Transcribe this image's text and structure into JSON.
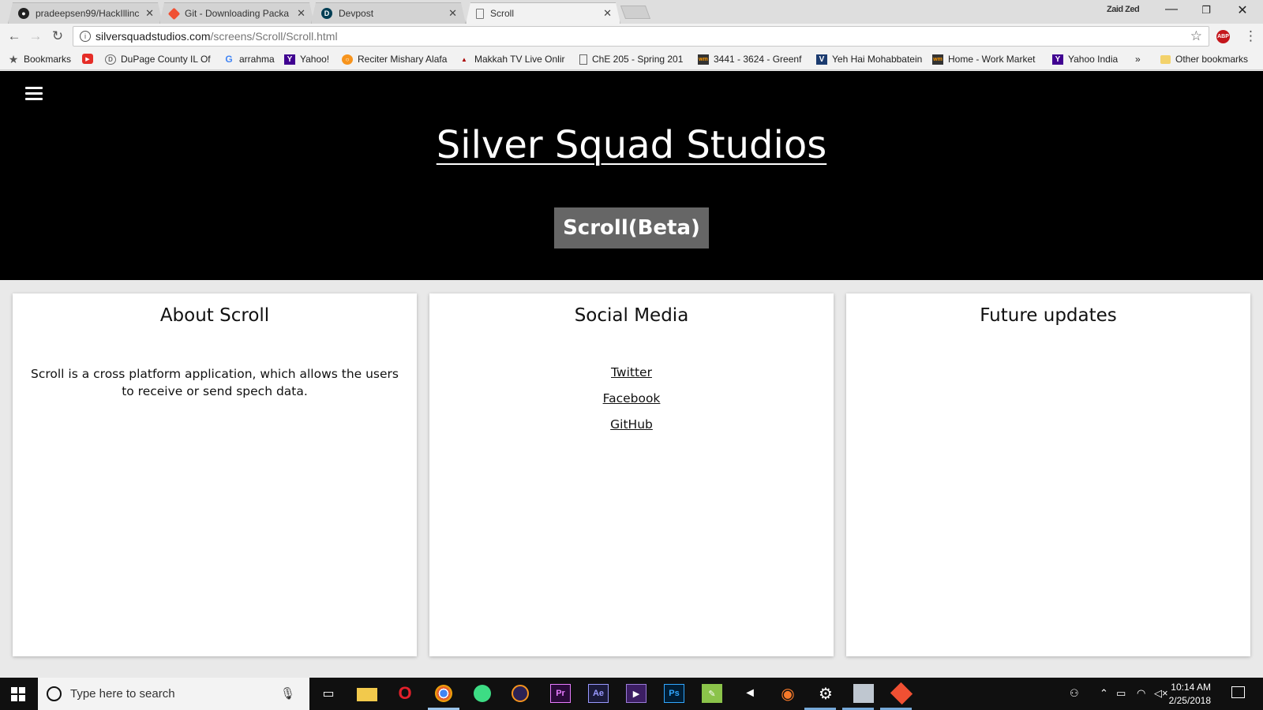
{
  "browser": {
    "tabs": [
      {
        "title": "pradeepsen99/HackIllinc",
        "favicon": "github-icon"
      },
      {
        "title": "Git - Downloading Packa",
        "favicon": "git-icon"
      },
      {
        "title": "Devpost",
        "favicon": "devpost-icon"
      },
      {
        "title": "Scroll",
        "favicon": "page-icon",
        "active": true
      }
    ],
    "profile_name": "Zaid Zed",
    "url_host": "silversquadstudios.com",
    "url_path": "/screens/Scroll/Scroll.html",
    "abp_label": "ABP"
  },
  "bookmarks": [
    {
      "label": "Bookmarks",
      "icon": "star-icon"
    },
    {
      "label": "",
      "icon": "youtube-icon"
    },
    {
      "label": "DuPage County IL Of",
      "icon": "dupage-icon"
    },
    {
      "label": "arrahma",
      "icon": "google-icon"
    },
    {
      "label": "Yahoo!",
      "icon": "yahoo-icon"
    },
    {
      "label": "Reciter Mishary Alafa",
      "icon": "reciter-icon"
    },
    {
      "label": "Makkah TV Live Onlir",
      "icon": "makkah-icon"
    },
    {
      "label": "ChE 205 - Spring 201",
      "icon": "document-icon"
    },
    {
      "label": "3441 - 3624 - Greenf",
      "icon": "workmarket-icon"
    },
    {
      "label": "Yeh Hai Mohabbatein",
      "icon": "yeh-hai-icon"
    },
    {
      "label": "Home - Work Market",
      "icon": "workmarket-icon"
    },
    {
      "label": "Yahoo India",
      "icon": "yahoo-icon"
    },
    {
      "label": "»",
      "icon": ""
    },
    {
      "label": "Other bookmarks",
      "icon": "folder-icon"
    }
  ],
  "page": {
    "site_title": "Silver Squad Studios",
    "badge": "Scroll(Beta)",
    "cards": [
      {
        "title": "About Scroll",
        "body": "Scroll is a cross platform application, which allows the users to receive or send spech data."
      },
      {
        "title": "Social Media",
        "links": [
          "Twitter",
          "Facebook",
          "GitHub"
        ]
      },
      {
        "title": "Future updates"
      }
    ]
  },
  "taskbar": {
    "search_placeholder": "Type here to search",
    "time": "10:14 AM",
    "date": "2/25/2018",
    "apps": [
      "file-explorer-icon",
      "opera-icon",
      "chrome-icon",
      "android-studio-icon",
      "eclipse-icon",
      "premiere-icon",
      "after-effects-icon",
      "visual-studio-icon",
      "photoshop-icon",
      "notepad-icon",
      "unity-icon",
      "blender-icon",
      "settings-icon",
      "network-icon",
      "git-icon"
    ]
  },
  "colors": {
    "hero_bg": "#000000",
    "badge_bg": "#666666",
    "tab_active": "#f2f2f2",
    "taskbar": "#101010"
  }
}
